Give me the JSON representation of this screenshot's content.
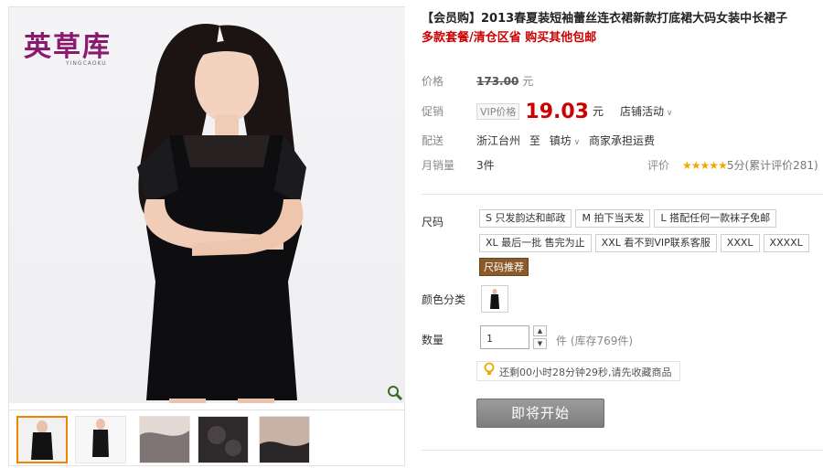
{
  "brand": {
    "logo_cn": "英草库",
    "logo_en": "YINGCAOKU"
  },
  "product": {
    "title": "【会员购】2013春夏装短袖蕾丝连衣裙新款打底裙大码女装中长裙子",
    "subtitle": "多款套餐/清仓区省 购买其他包邮"
  },
  "price": {
    "label": "价格",
    "original": "173.00",
    "unit": "元"
  },
  "promo": {
    "label": "促销",
    "vip_tag": "VIP价格",
    "price": "19.03",
    "unit": "元",
    "activity": "店铺活动"
  },
  "delivery": {
    "label": "配送",
    "from": "浙江台州",
    "to_label": "至",
    "to": "镇坊",
    "fee": "商家承担运费"
  },
  "sales": {
    "label": "月销量",
    "count": "3件",
    "rating_label": "评价",
    "stars": "★★★★★",
    "score_text": "5分(累计评价281)"
  },
  "sizes": {
    "label": "尺码",
    "options": [
      "S 只发韵达和邮政",
      "M 拍下当天发",
      "L 搭配任何一款袜子免邮",
      "XL 最后一批 售完为止",
      "XXL 看不到VIP联系客服",
      "XXXL",
      "XXXXL"
    ],
    "guide": "尺码推荐"
  },
  "color": {
    "label": "颜色分类"
  },
  "quantity": {
    "label": "数量",
    "value": "1",
    "stock_text": "件 (库存769件)"
  },
  "notice": {
    "text": "还剩00小时28分钟29秒,请先收藏商品"
  },
  "buy": {
    "label": "即将开始"
  },
  "colors": {
    "accent_red": "#cc0000",
    "star": "#f5a700",
    "button_gray": "#8a8a8a"
  }
}
